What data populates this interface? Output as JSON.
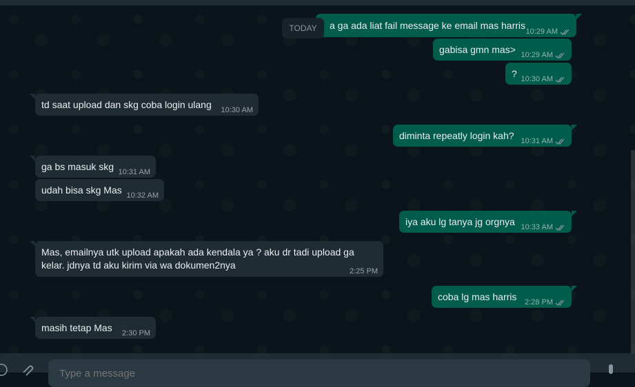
{
  "date_chip": "TODAY",
  "messages": [
    {
      "dir": "out",
      "text": "a ga ada liat fail message ke email mas harris",
      "time": "10:29 AM"
    },
    {
      "dir": "out",
      "text": "gabisa gmn mas>",
      "time": "10:29 AM"
    },
    {
      "dir": "out",
      "text": "?",
      "time": "10:30 AM"
    },
    {
      "dir": "in",
      "text": "td saat upload dan skg coba login ulang",
      "time": "10:30 AM"
    },
    {
      "dir": "out",
      "text": "diminta repeatly login kah?",
      "time": "10:31 AM"
    },
    {
      "dir": "in",
      "text": "ga bs masuk skg",
      "time": "10:31 AM"
    },
    {
      "dir": "in",
      "text": "udah bisa skg Mas",
      "time": "10:32 AM"
    },
    {
      "dir": "out",
      "text": "iya aku lg tanya jg orgnya",
      "time": "10:33 AM"
    },
    {
      "dir": "in",
      "text": "Mas, emailnya utk upload apakah ada kendala ya ? aku dr tadi upload ga\nkelar. jdnya td aku kirim via wa dokumen2nya",
      "time": "2:25 PM"
    },
    {
      "dir": "out",
      "text": "coba lg mas harris",
      "time": "2:28 PM"
    },
    {
      "dir": "in",
      "text": "masih tetap Mas",
      "time": "2:30 PM"
    }
  ],
  "composer": {
    "placeholder": "Type a message"
  },
  "colors": {
    "background": "#0b141a",
    "incoming": "#202c33",
    "outgoing": "#005c4b",
    "read_tick": "#8696a0"
  },
  "icons": [
    "emoji-icon",
    "attach-icon",
    "microphone-icon",
    "double-check-icon"
  ]
}
